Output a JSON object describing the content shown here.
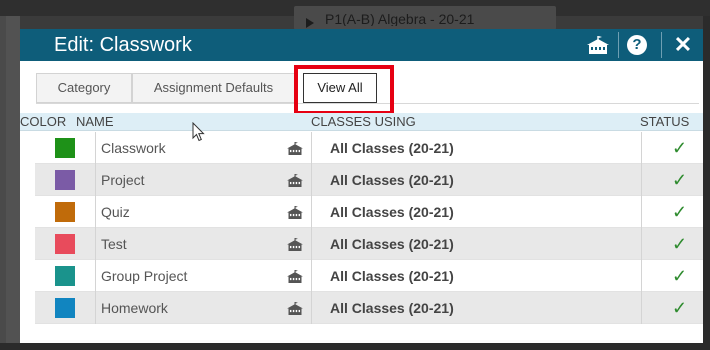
{
  "background": {
    "tab_label": "P1(A-B) Algebra - 20-21"
  },
  "modal": {
    "title": "Edit: Classwork",
    "icons": {
      "classes_icon": "school-icon",
      "help": "?",
      "close": "✕"
    }
  },
  "tabs": [
    {
      "label": "Category",
      "active": false
    },
    {
      "label": "Assignment Defaults",
      "active": false
    },
    {
      "label": "View All",
      "active": true
    }
  ],
  "table": {
    "headers": {
      "color": "COLOR",
      "name": "NAME",
      "classes": "CLASSES USING",
      "status": "STATUS"
    },
    "rows": [
      {
        "color": "#1e9118",
        "name": "Classwork",
        "classes": "All Classes  (20-21)",
        "status": "✓"
      },
      {
        "color": "#7b5ba6",
        "name": "Project",
        "classes": "All Classes  (20-21)",
        "status": "✓"
      },
      {
        "color": "#c06b0a",
        "name": "Quiz",
        "classes": "All Classes  (20-21)",
        "status": "✓"
      },
      {
        "color": "#e84b5c",
        "name": "Test",
        "classes": "All Classes  (20-21)",
        "status": "✓"
      },
      {
        "color": "#1a938c",
        "name": "Group Project",
        "classes": "All Classes  (20-21)",
        "status": "✓"
      },
      {
        "color": "#1185c0",
        "name": "Homework",
        "classes": "All Classes  (20-21)",
        "status": "✓"
      }
    ]
  }
}
